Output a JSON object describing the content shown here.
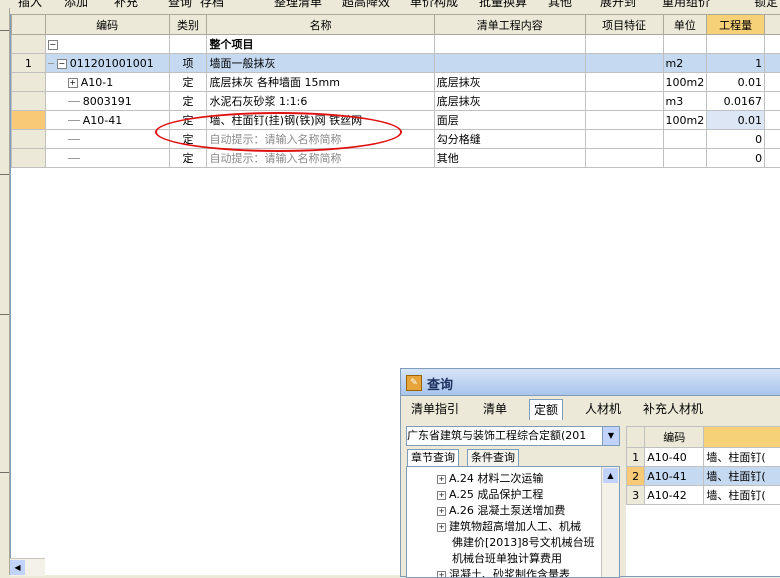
{
  "toolbar": {
    "items": [
      "插入",
      "添加",
      "补充",
      "查询",
      "存档",
      "整理清单",
      "超高降效",
      "单价构成",
      "批量换算",
      "其他",
      "展开到",
      "重用组价",
      "锁定"
    ]
  },
  "grid": {
    "headers": {
      "code": "编码",
      "type": "类别",
      "name": "名称",
      "content": "清单工程内容",
      "feature": "项目特征",
      "unit": "单位",
      "qty": "工程量"
    },
    "rows": [
      {
        "num": "",
        "code": "",
        "type": "",
        "name": "整个项目",
        "content": "",
        "unit": "",
        "qty": ""
      },
      {
        "num": "1",
        "code": "011201001001",
        "type": "项",
        "name": "墙面一般抹灰",
        "content": "",
        "unit": "m2",
        "qty": "1"
      },
      {
        "num": "",
        "code": "A10-1",
        "type": "定",
        "name": "底层抹灰 各种墙面 15mm",
        "content": "底层抹灰",
        "unit": "100m2",
        "qty": "0.01"
      },
      {
        "num": "",
        "code": "8003191",
        "type": "定",
        "name": "水泥石灰砂浆 1:1:6",
        "content": "底层抹灰",
        "unit": "m3",
        "qty": "0.0167"
      },
      {
        "num": "",
        "code": "A10-41",
        "type": "定",
        "name": "墙、柱面钉(挂)钢(铁)网 铁丝网",
        "content": "面层",
        "unit": "100m2",
        "qty": "0.01"
      },
      {
        "num": "",
        "code": "",
        "type": "定",
        "name": "自动提示：请输入名称简称",
        "content": "勾分格缝",
        "unit": "",
        "qty": "0"
      },
      {
        "num": "",
        "code": "",
        "type": "定",
        "name": "自动提示：请输入名称简称",
        "content": "其他",
        "unit": "",
        "qty": "0"
      }
    ]
  },
  "panel": {
    "title": "查询",
    "tabs": [
      "清单指引",
      "清单",
      "定额",
      "人材机",
      "补充人材机"
    ],
    "combo_value": "广东省建筑与装饰工程综合定额(201",
    "subtabs": [
      "章节查询",
      "条件查询"
    ],
    "tree": [
      {
        "label": "A.24 材料二次运输",
        "expandable": true
      },
      {
        "label": "A.25 成品保护工程",
        "expandable": true
      },
      {
        "label": "A.26 混凝土泵送增加费",
        "expandable": true
      },
      {
        "label": "建筑物超高增加人工、机械",
        "expandable": true
      },
      {
        "label": "佛建价[2013]8号文机械台班",
        "expandable": false
      },
      {
        "label": "机械台班单独计算费用",
        "expandable": false
      },
      {
        "label": "混凝土、砂浆制作含量表",
        "expandable": true
      }
    ],
    "result_header_code": "编码",
    "results": [
      {
        "num": "1",
        "code": "A10-40",
        "name": "墙、柱面钉("
      },
      {
        "num": "2",
        "code": "A10-41",
        "name": "墙、柱面钉("
      },
      {
        "num": "3",
        "code": "A10-42",
        "name": "墙、柱面钉("
      }
    ]
  },
  "colors": {
    "selection": "#c5d9f1",
    "header_highlight": "#f6d178",
    "annotation": "#e01010"
  }
}
